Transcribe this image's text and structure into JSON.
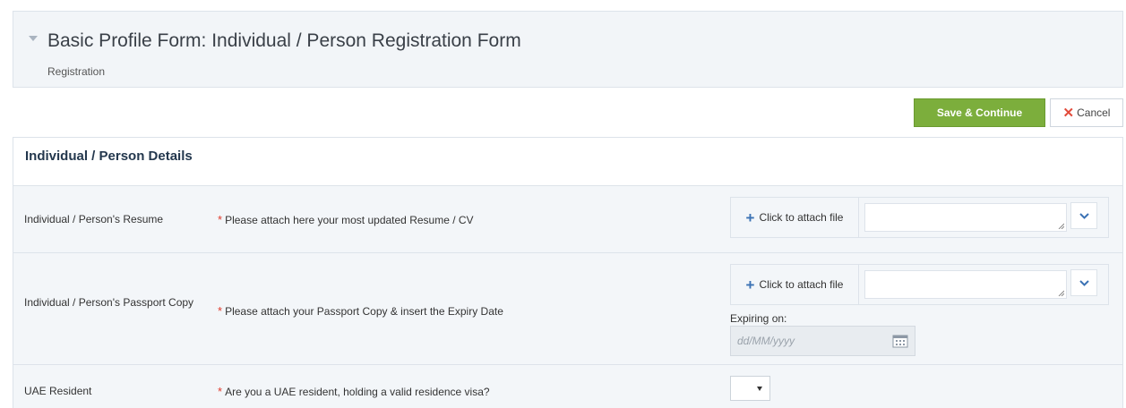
{
  "header": {
    "title": "Basic Profile Form: Individual / Person Registration Form",
    "subtitle": "Registration"
  },
  "toolbar": {
    "save_label": "Save & Continue",
    "cancel_label": "Cancel"
  },
  "section": {
    "title": "Individual / Person Details"
  },
  "fields": {
    "resume": {
      "label": "Individual / Person's Resume",
      "required_mark": "*",
      "description": "Please attach here your most updated Resume / CV",
      "attach_label": "Click to attach file"
    },
    "passport": {
      "label": "Individual / Person's Passport Copy",
      "required_mark": "*",
      "description": "Please attach your Passport Copy & insert the Expiry Date",
      "attach_label": "Click to attach file",
      "expiring_label": "Expiring on:",
      "date_placeholder": "dd/MM/yyyy"
    },
    "uae": {
      "label": "UAE Resident",
      "required_mark": "*",
      "description": "Are you a UAE resident, holding a valid residence visa?",
      "selected_value": ""
    }
  },
  "icons": {
    "header_toggle": "chevron-down-icon",
    "attach": "plus-icon",
    "dropdown": "chevron-down-icon",
    "calendar": "calendar-icon",
    "cancel": "close-icon",
    "required": "asterisk-icon"
  },
  "colors": {
    "save_button": "#7cae3c",
    "cancel_icon": "#e24b3b",
    "required_mark": "#e03a2c",
    "accent_blue": "#3b72b4",
    "section_title": "#24384e"
  }
}
